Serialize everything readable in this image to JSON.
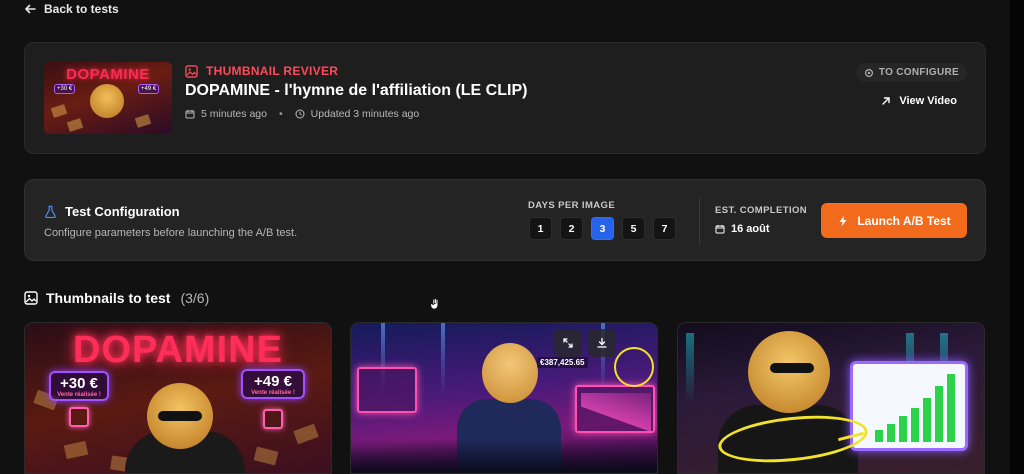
{
  "nav": {
    "back_label": "Back to tests"
  },
  "video": {
    "thumb_text": "DOPAMINE",
    "thumb_badges": [
      "+30 €",
      "+49 €"
    ],
    "kicker": "THUMBNAIL REVIVER",
    "title": "DOPAMINE - l'hymne de l'affiliation (LE CLIP)",
    "created": "5 minutes ago",
    "updated": "Updated 3 minutes ago",
    "status": "TO CONFIGURE",
    "view_label": "View Video"
  },
  "config": {
    "title": "Test Configuration",
    "subtitle": "Configure parameters before launching the A/B test.",
    "days_label": "DAYS PER IMAGE",
    "days_options": [
      "1",
      "2",
      "3",
      "5",
      "7"
    ],
    "days_selected": "3",
    "est_label": "EST. COMPLETION",
    "est_value": "16 août",
    "launch_label": "Launch A/B Test"
  },
  "thumbnails": {
    "title": "Thumbnails to test",
    "count": "(3/6)",
    "items": [
      {
        "neon_text": "DOPAMINE",
        "badge_left": "+30 €",
        "badge_left_sub": "Vente réalisée !",
        "badge_right": "+49 €",
        "badge_right_sub": "Vente réalisée !"
      },
      {
        "money_text": "€387,425.65"
      },
      {}
    ]
  },
  "colors": {
    "accent_orange": "#f26a1b",
    "active_blue": "#2563eb",
    "kicker_red": "#ff4a5c",
    "neon_pink": "#ff2e58"
  }
}
